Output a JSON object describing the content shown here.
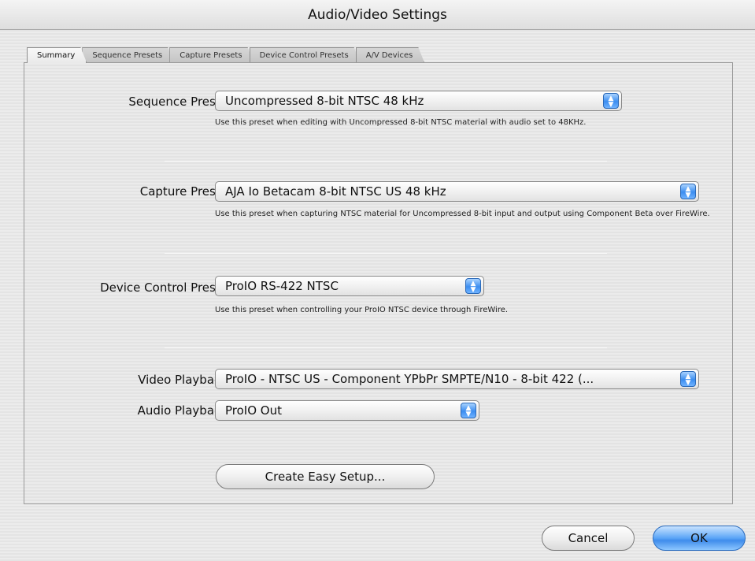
{
  "window": {
    "title": "Audio/Video Settings"
  },
  "tabs": [
    {
      "label": "Summary",
      "active": true
    },
    {
      "label": "Sequence Presets",
      "active": false
    },
    {
      "label": "Capture Presets",
      "active": false
    },
    {
      "label": "Device Control Presets",
      "active": false
    },
    {
      "label": "A/V Devices",
      "active": false
    }
  ],
  "summary": {
    "sequence_preset": {
      "label": "Sequence Preset:",
      "value": "Uncompressed 8-bit NTSC 48 kHz",
      "help": "Use this preset when editing with Uncompressed 8-bit NTSC material with audio set to 48KHz."
    },
    "capture_preset": {
      "label": "Capture Preset:",
      "value": "AJA Io Betacam 8-bit NTSC US 48 kHz",
      "help": "Use this preset when capturing NTSC material for Uncompressed 8-bit input and output using Component Beta over FireWire."
    },
    "device_control_preset": {
      "label": "Device Control Preset:",
      "value": "ProIO RS-422 NTSC",
      "help": "Use this preset when controlling your ProIO NTSC device through FireWire."
    },
    "video_playback": {
      "label": "Video Playback:",
      "value": "ProIO - NTSC US - Component YPbPr SMPTE/N10 - 8-bit 422 (..."
    },
    "audio_playback": {
      "label": "Audio Playback:",
      "value": "ProIO Out"
    },
    "create_easy_setup_label": "Create Easy Setup..."
  },
  "footer": {
    "cancel_label": "Cancel",
    "ok_label": "OK"
  },
  "colors": {
    "accent": "#3b8df0",
    "background": "#e8e8e8"
  },
  "icons": {
    "popup_arrows": "updown-arrows-icon"
  }
}
